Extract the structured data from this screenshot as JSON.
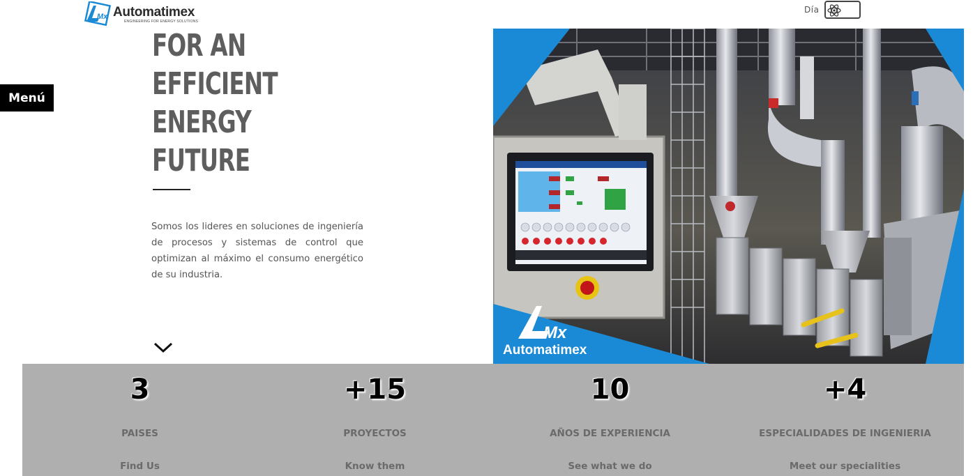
{
  "header": {
    "logo_mark": "Mx",
    "logo_name": "Automatimex",
    "logo_tagline": "ENGINEERING FOR ENERGY SOLUTIONS",
    "mode_label": "Día",
    "mode_icon": "atom-icon"
  },
  "menu": {
    "label": "Menú"
  },
  "hero": {
    "title_lines": [
      "FOR AN",
      "EFFICIENT",
      "ENERGY",
      "FUTURE"
    ],
    "description": "Somos los lideres en soluciones de ingeniería de procesos y sistemas de control que optimizan al máximo el consumo energético de su industria.",
    "scroll_icon": "chevron-down-icon",
    "image": {
      "subject": "industrial control panel with touchscreen HMI and stainless steel process piping",
      "overlay_logo_mark": "Mx",
      "overlay_logo_name": "Automatimex"
    }
  },
  "stats": [
    {
      "value": "3",
      "label": "PAISES",
      "link": "Find Us"
    },
    {
      "value": "+15",
      "label": "PROYECTOS",
      "link": "Know them"
    },
    {
      "value": "10",
      "label": "AÑOS DE EXPERIENCIA",
      "link": "See what we do"
    },
    {
      "value": "+4",
      "label": "ESPECIALIDADES DE INGENIERIA",
      "link": "Meet our specialities"
    }
  ],
  "colors": {
    "brand_blue": "#1a8ad6",
    "title_gray": "#5e5e5e",
    "stats_band": "#afafaf",
    "menu_bg": "#000000"
  }
}
